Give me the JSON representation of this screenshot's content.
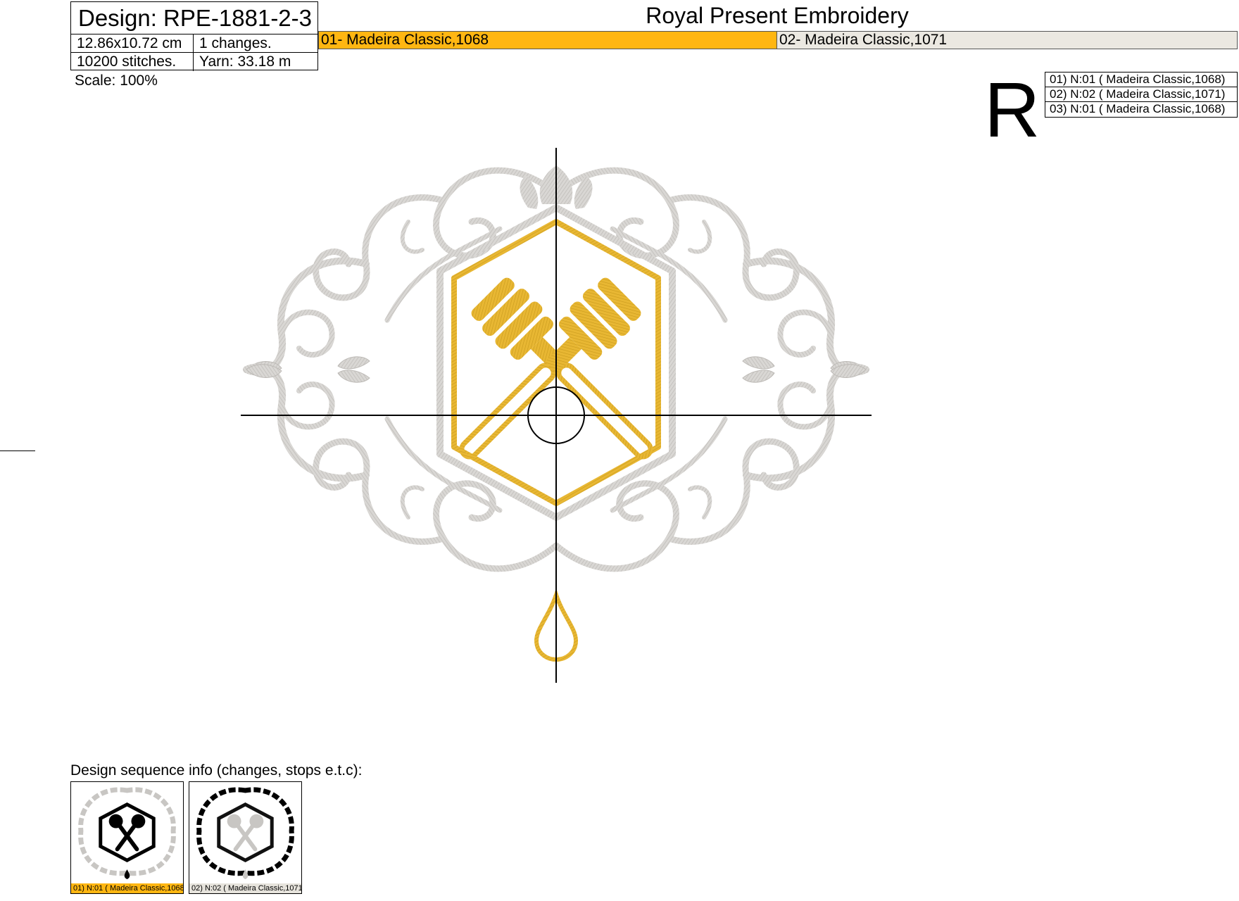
{
  "header": {
    "design_title": "Design: RPE-1881-2-3",
    "size": "12.86x10.72 cm",
    "changes": "1 changes.",
    "stitches": "10200 stitches.",
    "yarn": "Yarn: 33.18 m",
    "company": "Royal Present Embroidery"
  },
  "color_bars": [
    {
      "label": "01- Madeira Classic,1068",
      "color": "#ffb612"
    },
    {
      "label": "02- Madeira Classic,1071",
      "color": "#ebe8e1"
    }
  ],
  "scale": "Scale: 100%",
  "logo_letter": "R",
  "legend": [
    "01) N:01 ( Madeira Classic,1068)",
    "02) N:02 ( Madeira Classic,1071)",
    "03) N:01 ( Madeira Classic,1068)"
  ],
  "sequence": {
    "title": "Design sequence info (changes, stops e.t.c):",
    "thumbs": [
      {
        "label": "01) N:01 ( Madeira Classic,1068)",
        "label_bg": "#ffb612"
      },
      {
        "label": "02) N:02 ( Madeira Classic,1071)",
        "label_bg": "#e6e3dc"
      }
    ]
  },
  "thread_colors": {
    "gold": "#e3b52e",
    "silver": "#cfcdcb"
  }
}
